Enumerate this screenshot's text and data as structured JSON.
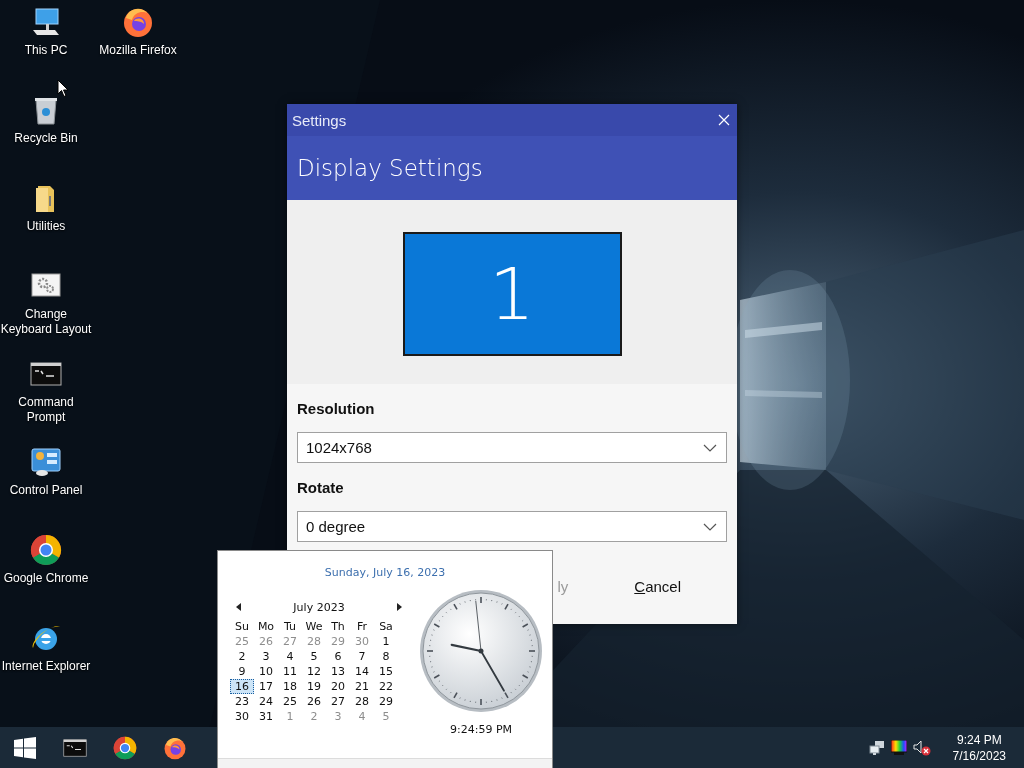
{
  "desktop_icons": [
    {
      "label": "This PC",
      "kind": "pc"
    },
    {
      "label": "Recycle Bin",
      "kind": "bin"
    },
    {
      "label": "Utilities",
      "kind": "folder"
    },
    {
      "label": "Change\nKeyboard Layout",
      "kind": "gears"
    },
    {
      "label": "Command\nPrompt",
      "kind": "cmd"
    },
    {
      "label": "Control Panel",
      "kind": "control"
    },
    {
      "label": "Google Chrome",
      "kind": "chrome"
    },
    {
      "label": "Internet Explorer",
      "kind": "ie"
    },
    {
      "label": "Mozilla Firefox",
      "kind": "firefox"
    }
  ],
  "dialog": {
    "title": "Settings",
    "header": "Display Settings",
    "monitor_label": "1",
    "fields": [
      {
        "label": "Resolution",
        "value": "1024x768"
      },
      {
        "label": "Rotate",
        "value": "0 degree"
      }
    ],
    "buttons": [
      {
        "label": "ly",
        "mnemonic": false
      },
      {
        "label": "Cancel",
        "mnemonic": true
      }
    ]
  },
  "calendar": {
    "date_heading": "Sunday, July 16, 2023",
    "month": "July 2023",
    "weekdays": [
      "Su",
      "Mo",
      "Tu",
      "We",
      "Th",
      "Fr",
      "Sa"
    ],
    "weeks": [
      [
        {
          "d": "25",
          "other_month": true,
          "selected": false
        },
        {
          "d": "26",
          "other_month": true,
          "selected": false
        },
        {
          "d": "27",
          "other_month": true,
          "selected": false
        },
        {
          "d": "28",
          "other_month": true,
          "selected": false
        },
        {
          "d": "29",
          "other_month": true,
          "selected": false
        },
        {
          "d": "30",
          "other_month": true,
          "selected": false
        },
        {
          "d": "1",
          "other_month": false,
          "selected": false
        }
      ],
      [
        {
          "d": "2",
          "other_month": false,
          "selected": false
        },
        {
          "d": "3",
          "other_month": false,
          "selected": false
        },
        {
          "d": "4",
          "other_month": false,
          "selected": false
        },
        {
          "d": "5",
          "other_month": false,
          "selected": false
        },
        {
          "d": "6",
          "other_month": false,
          "selected": false
        },
        {
          "d": "7",
          "other_month": false,
          "selected": false
        },
        {
          "d": "8",
          "other_month": false,
          "selected": false
        }
      ],
      [
        {
          "d": "9",
          "other_month": false,
          "selected": false
        },
        {
          "d": "10",
          "other_month": false,
          "selected": false
        },
        {
          "d": "11",
          "other_month": false,
          "selected": false
        },
        {
          "d": "12",
          "other_month": false,
          "selected": false
        },
        {
          "d": "13",
          "other_month": false,
          "selected": false
        },
        {
          "d": "14",
          "other_month": false,
          "selected": false
        },
        {
          "d": "15",
          "other_month": false,
          "selected": false
        }
      ],
      [
        {
          "d": "16",
          "other_month": false,
          "selected": true
        },
        {
          "d": "17",
          "other_month": false,
          "selected": false
        },
        {
          "d": "18",
          "other_month": false,
          "selected": false
        },
        {
          "d": "19",
          "other_month": false,
          "selected": false
        },
        {
          "d": "20",
          "other_month": false,
          "selected": false
        },
        {
          "d": "21",
          "other_month": false,
          "selected": false
        },
        {
          "d": "22",
          "other_month": false,
          "selected": false
        }
      ],
      [
        {
          "d": "23",
          "other_month": false,
          "selected": false
        },
        {
          "d": "24",
          "other_month": false,
          "selected": false
        },
        {
          "d": "25",
          "other_month": false,
          "selected": false
        },
        {
          "d": "26",
          "other_month": false,
          "selected": false
        },
        {
          "d": "27",
          "other_month": false,
          "selected": false
        },
        {
          "d": "28",
          "other_month": false,
          "selected": false
        },
        {
          "d": "29",
          "other_month": false,
          "selected": false
        }
      ],
      [
        {
          "d": "30",
          "other_month": false,
          "selected": false
        },
        {
          "d": "31",
          "other_month": false,
          "selected": false
        },
        {
          "d": "1",
          "other_month": true,
          "selected": false
        },
        {
          "d": "2",
          "other_month": true,
          "selected": false
        },
        {
          "d": "3",
          "other_month": true,
          "selected": false
        },
        {
          "d": "4",
          "other_month": true,
          "selected": false
        },
        {
          "d": "5",
          "other_month": true,
          "selected": false
        }
      ]
    ],
    "time": "9:24:59 PM"
  },
  "taskbar": {
    "apps": [
      {
        "kind": "start"
      },
      {
        "kind": "cmd"
      },
      {
        "kind": "chrome"
      },
      {
        "kind": "firefox"
      }
    ],
    "tray": {
      "muted": true,
      "time": "9:24 PM",
      "date": "7/16/2023"
    }
  }
}
